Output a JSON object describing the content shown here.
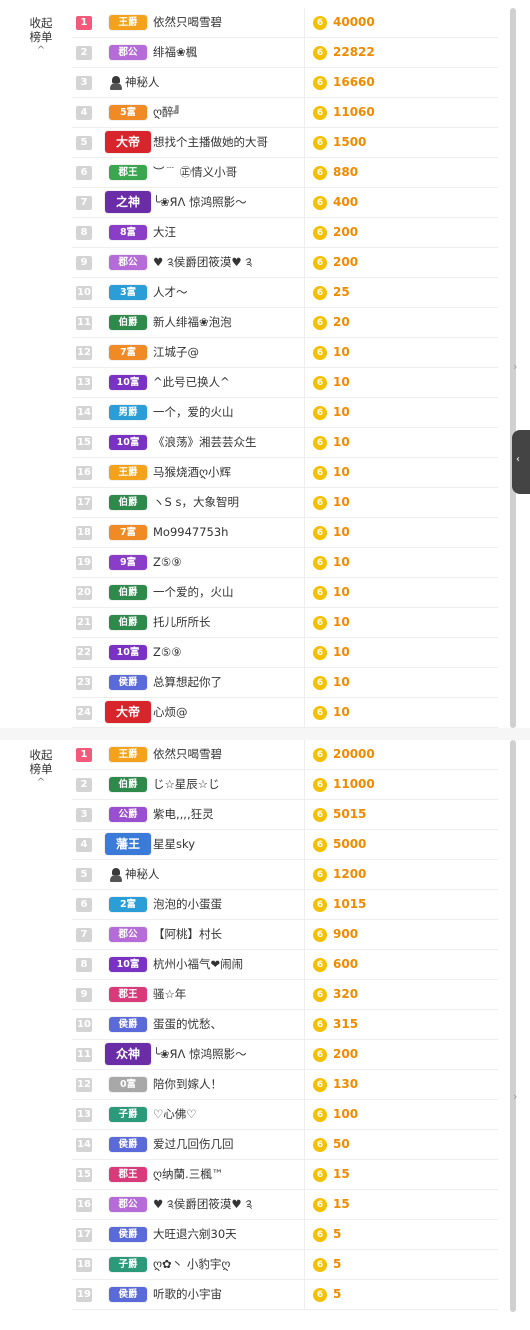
{
  "collapse": {
    "line1": "收起",
    "line2": "榜单",
    "caret": "^"
  },
  "coin_glyph": "6",
  "side_arrow": "›",
  "side_tab_arrow": "‹",
  "colors": {
    "coin": "#f5c000",
    "score": "#f08a00",
    "rank_first": "#f35a7a",
    "rank_default": "#d4d4d4"
  },
  "panel1": {
    "rows": [
      {
        "rank": "1",
        "badge": "王爵",
        "color": "#f4a21b",
        "name": "依然只喝雪碧",
        "score": "40000"
      },
      {
        "rank": "2",
        "badge": "郡公",
        "color": "#b56bd8",
        "name": "绯福❀楓",
        "score": "22822"
      },
      {
        "rank": "3",
        "badge": "",
        "color": "",
        "name": "神秘人",
        "score": "16660"
      },
      {
        "rank": "4",
        "badge": "5富",
        "color": "#f08a24",
        "name": "ღ醉╝",
        "score": "11060"
      },
      {
        "rank": "5",
        "badge": "大帝",
        "color": "#d8252b",
        "name": "想找个主播做她的大哥",
        "score": "1500",
        "big": true
      },
      {
        "rank": "6",
        "badge": "郡王",
        "color": "#3aa64f",
        "name": "︶﹉ ㊣情义小哥",
        "score": "880"
      },
      {
        "rank": "7",
        "badge": "之神",
        "color": "#6b2ca8",
        "name": "╰❀ЯΛ 惊鸿照影～",
        "score": "400",
        "big": true
      },
      {
        "rank": "8",
        "badge": "8富",
        "color": "#8a3ec8",
        "name": "大汪",
        "score": "200"
      },
      {
        "rank": "9",
        "badge": "郡公",
        "color": "#b56bd8",
        "name": "♥ ༉侯爵团筱漠♥ ༉",
        "score": "200"
      },
      {
        "rank": "10",
        "badge": "3富",
        "color": "#2b9ed8",
        "name": "人才～",
        "score": "25"
      },
      {
        "rank": "11",
        "badge": "伯爵",
        "color": "#2e8a4a",
        "name": "新人绯福❀泡泡",
        "score": "20"
      },
      {
        "rank": "12",
        "badge": "7富",
        "color": "#f08a24",
        "name": "江城子@",
        "score": "10"
      },
      {
        "rank": "13",
        "badge": "10富",
        "color": "#7a32c4",
        "name": "^此号已换人^",
        "score": "10"
      },
      {
        "rank": "14",
        "badge": "男爵",
        "color": "#2b9ed8",
        "name": "一个，爱的火山",
        "score": "10"
      },
      {
        "rank": "15",
        "badge": "10富",
        "color": "#7a32c4",
        "name": "《浪荡》湘芸芸众生",
        "score": "10"
      },
      {
        "rank": "16",
        "badge": "王爵",
        "color": "#f4a21b",
        "name": "马猴烧酒ღ小辉",
        "score": "10"
      },
      {
        "rank": "17",
        "badge": "伯爵",
        "color": "#2e8a4a",
        "name": "ヽS s，大象智明",
        "score": "10"
      },
      {
        "rank": "18",
        "badge": "7富",
        "color": "#f08a24",
        "name": "Mo9947753h",
        "score": "10"
      },
      {
        "rank": "19",
        "badge": "9富",
        "color": "#8a3ec8",
        "name": "Z⑤⑨",
        "score": "10"
      },
      {
        "rank": "20",
        "badge": "伯爵",
        "color": "#2e8a4a",
        "name": "一个爱的，火山",
        "score": "10"
      },
      {
        "rank": "21",
        "badge": "伯爵",
        "color": "#2e8a4a",
        "name": "托儿所所长",
        "score": "10"
      },
      {
        "rank": "22",
        "badge": "10富",
        "color": "#7a32c4",
        "name": "Z⑤⑨",
        "score": "10"
      },
      {
        "rank": "23",
        "badge": "侯爵",
        "color": "#5a6ad8",
        "name": "总算想起你了",
        "score": "10"
      },
      {
        "rank": "24",
        "badge": "大帝",
        "color": "#d8252b",
        "name": "心烦@",
        "score": "10",
        "big": true
      }
    ]
  },
  "panel2": {
    "rows": [
      {
        "rank": "1",
        "badge": "王爵",
        "color": "#f4a21b",
        "name": "依然只喝雪碧",
        "score": "20000"
      },
      {
        "rank": "2",
        "badge": "伯爵",
        "color": "#2e8a4a",
        "name": "じ☆星辰☆じ",
        "score": "11000"
      },
      {
        "rank": "3",
        "badge": "公爵",
        "color": "#9a4ed0",
        "name": "紫电,,,,狂灵",
        "score": "5015"
      },
      {
        "rank": "4",
        "badge": "藩王",
        "color": "#3a7ad8",
        "name": "星星sky",
        "score": "5000",
        "big": true
      },
      {
        "rank": "5",
        "badge": "",
        "color": "",
        "name": "神秘人",
        "score": "1200"
      },
      {
        "rank": "6",
        "badge": "2富",
        "color": "#2b9ed8",
        "name": "泡泡的小蛋蛋",
        "score": "1015"
      },
      {
        "rank": "7",
        "badge": "郡公",
        "color": "#b56bd8",
        "name": "【阿桃】村长",
        "score": "900"
      },
      {
        "rank": "8",
        "badge": "10富",
        "color": "#7a32c4",
        "name": "杭州小福气❤闹闹",
        "score": "600"
      },
      {
        "rank": "9",
        "badge": "郡王",
        "color": "#d83a7a",
        "name": "骚☆年",
        "score": "320"
      },
      {
        "rank": "10",
        "badge": "侯爵",
        "color": "#5a6ad8",
        "name": "蛋蛋的忧愁、",
        "score": "315"
      },
      {
        "rank": "11",
        "badge": "众神",
        "color": "#6b2ca8",
        "name": "╰❀ЯΛ 惊鸿照影～",
        "score": "200",
        "big": true
      },
      {
        "rank": "12",
        "badge": "0富",
        "color": "#a8a8a8",
        "name": "陪你到嫁人！",
        "score": "130"
      },
      {
        "rank": "13",
        "badge": "子爵",
        "color": "#2a9a7a",
        "name": "♡心佛♡",
        "score": "100"
      },
      {
        "rank": "14",
        "badge": "侯爵",
        "color": "#5a6ad8",
        "name": "爱过几回伤几回",
        "score": "50"
      },
      {
        "rank": "15",
        "badge": "郡王",
        "color": "#d83a7a",
        "name": "ღ纳蘭.三楓™",
        "score": "15"
      },
      {
        "rank": "16",
        "badge": "郡公",
        "color": "#b56bd8",
        "name": "♥ ༉侯爵团筱漠♥ ༉",
        "score": "15"
      },
      {
        "rank": "17",
        "badge": "侯爵",
        "color": "#5a6ad8",
        "name": "大旺退六剜30天",
        "score": "5"
      },
      {
        "rank": "18",
        "badge": "子爵",
        "color": "#2a9a7a",
        "name": "ღ✿丶 小豹宇ღ",
        "score": "5"
      },
      {
        "rank": "19",
        "badge": "侯爵",
        "color": "#5a6ad8",
        "name": "听歌的小宇宙",
        "score": "5"
      }
    ]
  }
}
